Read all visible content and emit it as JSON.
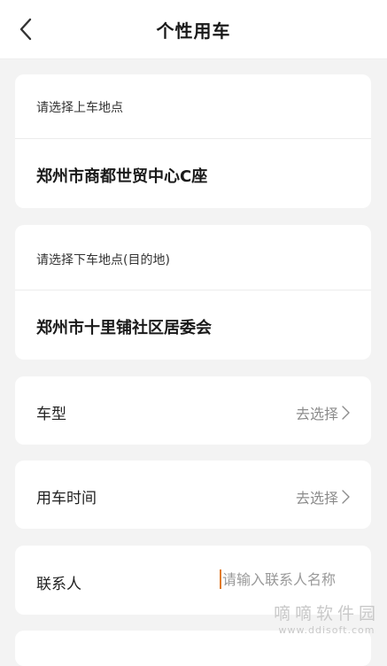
{
  "header": {
    "title": "个性用车",
    "back_icon": "chevron-left-icon"
  },
  "pickup": {
    "caption": "请选择上车地点",
    "value": "郑州市商都世贸中心C座"
  },
  "dropoff": {
    "caption": "请选择下车地点(目的地)",
    "value": "郑州市十里铺社区居委会"
  },
  "vehicle_type": {
    "label": "车型",
    "action": "去选择"
  },
  "ride_time": {
    "label": "用车时间",
    "action": "去选择"
  },
  "contact": {
    "label": "联系人",
    "value": "",
    "placeholder": "请输入联系人名称"
  },
  "watermark": {
    "main": "嘀嘀软件园",
    "sub": "www.ddisoft.com"
  },
  "colors": {
    "background": "#f3f3f3",
    "card": "#ffffff",
    "caret": "#e07b2a",
    "muted": "#8c8c8c"
  }
}
